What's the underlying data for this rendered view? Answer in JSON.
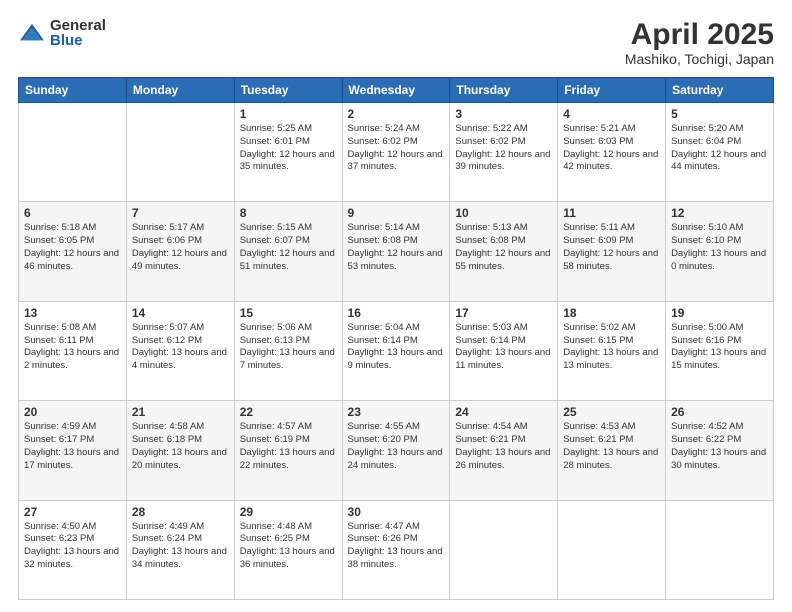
{
  "logo": {
    "general": "General",
    "blue": "Blue"
  },
  "title": "April 2025",
  "subtitle": "Mashiko, Tochigi, Japan",
  "days_of_week": [
    "Sunday",
    "Monday",
    "Tuesday",
    "Wednesday",
    "Thursday",
    "Friday",
    "Saturday"
  ],
  "weeks": [
    [
      {
        "day": "",
        "info": ""
      },
      {
        "day": "",
        "info": ""
      },
      {
        "day": "1",
        "info": "Sunrise: 5:25 AM\nSunset: 6:01 PM\nDaylight: 12 hours and 35 minutes."
      },
      {
        "day": "2",
        "info": "Sunrise: 5:24 AM\nSunset: 6:02 PM\nDaylight: 12 hours and 37 minutes."
      },
      {
        "day": "3",
        "info": "Sunrise: 5:22 AM\nSunset: 6:02 PM\nDaylight: 12 hours and 39 minutes."
      },
      {
        "day": "4",
        "info": "Sunrise: 5:21 AM\nSunset: 6:03 PM\nDaylight: 12 hours and 42 minutes."
      },
      {
        "day": "5",
        "info": "Sunrise: 5:20 AM\nSunset: 6:04 PM\nDaylight: 12 hours and 44 minutes."
      }
    ],
    [
      {
        "day": "6",
        "info": "Sunrise: 5:18 AM\nSunset: 6:05 PM\nDaylight: 12 hours and 46 minutes."
      },
      {
        "day": "7",
        "info": "Sunrise: 5:17 AM\nSunset: 6:06 PM\nDaylight: 12 hours and 49 minutes."
      },
      {
        "day": "8",
        "info": "Sunrise: 5:15 AM\nSunset: 6:07 PM\nDaylight: 12 hours and 51 minutes."
      },
      {
        "day": "9",
        "info": "Sunrise: 5:14 AM\nSunset: 6:08 PM\nDaylight: 12 hours and 53 minutes."
      },
      {
        "day": "10",
        "info": "Sunrise: 5:13 AM\nSunset: 6:08 PM\nDaylight: 12 hours and 55 minutes."
      },
      {
        "day": "11",
        "info": "Sunrise: 5:11 AM\nSunset: 6:09 PM\nDaylight: 12 hours and 58 minutes."
      },
      {
        "day": "12",
        "info": "Sunrise: 5:10 AM\nSunset: 6:10 PM\nDaylight: 13 hours and 0 minutes."
      }
    ],
    [
      {
        "day": "13",
        "info": "Sunrise: 5:08 AM\nSunset: 6:11 PM\nDaylight: 13 hours and 2 minutes."
      },
      {
        "day": "14",
        "info": "Sunrise: 5:07 AM\nSunset: 6:12 PM\nDaylight: 13 hours and 4 minutes."
      },
      {
        "day": "15",
        "info": "Sunrise: 5:06 AM\nSunset: 6:13 PM\nDaylight: 13 hours and 7 minutes."
      },
      {
        "day": "16",
        "info": "Sunrise: 5:04 AM\nSunset: 6:14 PM\nDaylight: 13 hours and 9 minutes."
      },
      {
        "day": "17",
        "info": "Sunrise: 5:03 AM\nSunset: 6:14 PM\nDaylight: 13 hours and 11 minutes."
      },
      {
        "day": "18",
        "info": "Sunrise: 5:02 AM\nSunset: 6:15 PM\nDaylight: 13 hours and 13 minutes."
      },
      {
        "day": "19",
        "info": "Sunrise: 5:00 AM\nSunset: 6:16 PM\nDaylight: 13 hours and 15 minutes."
      }
    ],
    [
      {
        "day": "20",
        "info": "Sunrise: 4:59 AM\nSunset: 6:17 PM\nDaylight: 13 hours and 17 minutes."
      },
      {
        "day": "21",
        "info": "Sunrise: 4:58 AM\nSunset: 6:18 PM\nDaylight: 13 hours and 20 minutes."
      },
      {
        "day": "22",
        "info": "Sunrise: 4:57 AM\nSunset: 6:19 PM\nDaylight: 13 hours and 22 minutes."
      },
      {
        "day": "23",
        "info": "Sunrise: 4:55 AM\nSunset: 6:20 PM\nDaylight: 13 hours and 24 minutes."
      },
      {
        "day": "24",
        "info": "Sunrise: 4:54 AM\nSunset: 6:21 PM\nDaylight: 13 hours and 26 minutes."
      },
      {
        "day": "25",
        "info": "Sunrise: 4:53 AM\nSunset: 6:21 PM\nDaylight: 13 hours and 28 minutes."
      },
      {
        "day": "26",
        "info": "Sunrise: 4:52 AM\nSunset: 6:22 PM\nDaylight: 13 hours and 30 minutes."
      }
    ],
    [
      {
        "day": "27",
        "info": "Sunrise: 4:50 AM\nSunset: 6:23 PM\nDaylight: 13 hours and 32 minutes."
      },
      {
        "day": "28",
        "info": "Sunrise: 4:49 AM\nSunset: 6:24 PM\nDaylight: 13 hours and 34 minutes."
      },
      {
        "day": "29",
        "info": "Sunrise: 4:48 AM\nSunset: 6:25 PM\nDaylight: 13 hours and 36 minutes."
      },
      {
        "day": "30",
        "info": "Sunrise: 4:47 AM\nSunset: 6:26 PM\nDaylight: 13 hours and 38 minutes."
      },
      {
        "day": "",
        "info": ""
      },
      {
        "day": "",
        "info": ""
      },
      {
        "day": "",
        "info": ""
      }
    ]
  ]
}
